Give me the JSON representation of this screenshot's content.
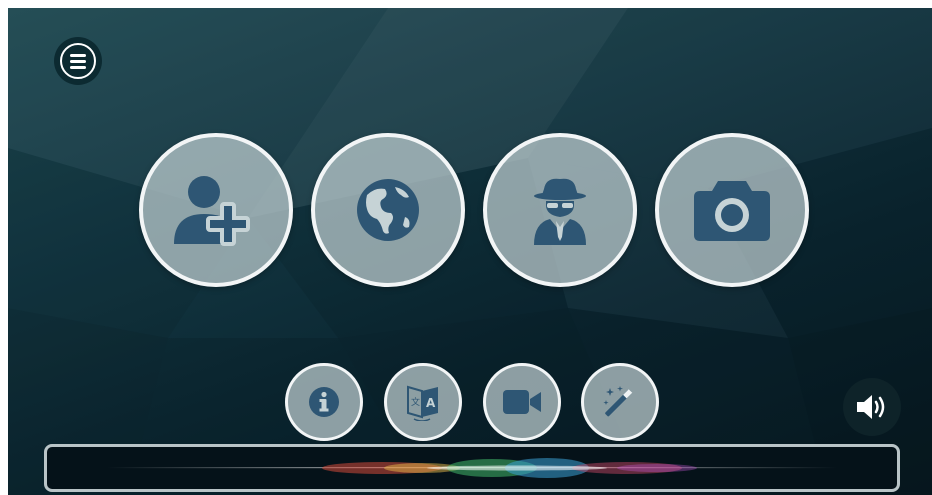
{
  "toolbar": {
    "menu_icon": "hamburger-menu-icon"
  },
  "main_actions": [
    {
      "id": "add-contact",
      "icon": "user-plus-icon"
    },
    {
      "id": "globe",
      "icon": "globe-icon"
    },
    {
      "id": "incognito",
      "icon": "spy-icon"
    },
    {
      "id": "camera",
      "icon": "camera-icon"
    }
  ],
  "secondary_actions": [
    {
      "id": "info",
      "icon": "info-icon"
    },
    {
      "id": "translate",
      "icon": "translate-icon"
    },
    {
      "id": "video",
      "icon": "video-camera-icon"
    },
    {
      "id": "magic",
      "icon": "magic-wand-icon"
    }
  ],
  "sound": {
    "icon": "speaker-volume-icon"
  },
  "voice_input": {
    "icon": "voice-waveform-icon"
  },
  "colors": {
    "background": "#0f2f38",
    "button_fill": "#c1d0d3",
    "button_border": "#f2f5f6",
    "icon": "#2e5674"
  }
}
